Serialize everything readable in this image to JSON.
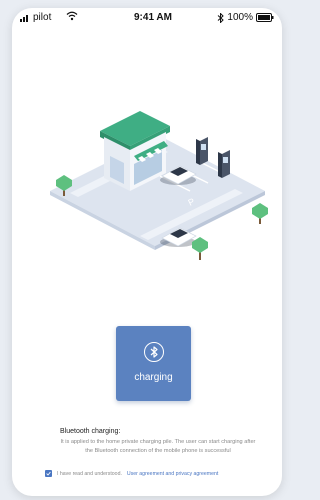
{
  "status_bar": {
    "carrier": "pilot",
    "time": "9:41 AM",
    "battery": "100%"
  },
  "illustration": {
    "parking_label": "P"
  },
  "charge_button": {
    "label": "charging",
    "icon": "bluetooth-icon"
  },
  "info": {
    "title": "Bluetooth charging:",
    "description": "It is applied to the home private charging pile. The user can start charging after the Bluetooth connection of the mobile phone is successful"
  },
  "agreement": {
    "checked": true,
    "text": "I have read and understood.",
    "link": "User agreement and privacy agreement"
  },
  "colors": {
    "accent": "#5b82c0",
    "link": "#4a76c2",
    "roof": "#3fae84"
  }
}
